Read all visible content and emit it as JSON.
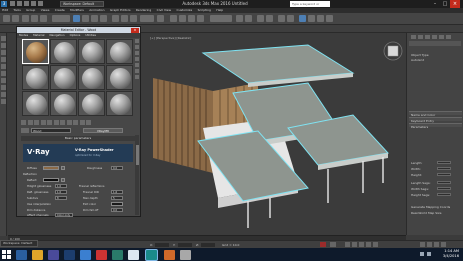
{
  "titlebar": {
    "workspace": "Workspace: Default",
    "title": "Autodesk 3ds Max 2016     Untitled",
    "search_placeholder": "Type a keyword or phrase"
  },
  "menubar": [
    "Edit",
    "Tools",
    "Group",
    "Views",
    "Create",
    "Modifiers",
    "Animation",
    "Graph Editors",
    "Rendering",
    "Civil View",
    "Customize",
    "Scripting",
    "Help"
  ],
  "viewport": {
    "label": "[+] [Perspective] [Realistic]"
  },
  "material_editor": {
    "title": "Material Editor - Wood",
    "menu": [
      "Modes",
      "Material",
      "Navigation",
      "Options",
      "Utilities"
    ],
    "material_name": "Wood",
    "material_type": "VRayMtl",
    "basic_header": "Basic parameters",
    "vray_logo": "V·Ray",
    "vray_caption": "V-Ray PowerShader",
    "vray_sub": "optimized for V-Ray",
    "params": {
      "diffuse": "Diffuse",
      "roughness": "Roughness",
      "reflection": "Reflection",
      "reflect": "Reflect",
      "hilight": "Hilight glossiness",
      "refl_gloss": "Refl. glossiness",
      "subdivs": "Subdivs",
      "use_interp": "Use interpolation",
      "dim_distance": "Dim distance",
      "affect_channels": "Affect channels",
      "fresnel": "Fresnel reflections",
      "fresnel_ior": "Fresnel IOR",
      "max_depth": "Max depth",
      "exit_color": "Exit color",
      "dim_falloff": "Dim fall off",
      "color_only": "Color only",
      "roughness_val": "0.0",
      "hilight_val": "1.0",
      "gloss_val": "1.0",
      "subdivs_val": "8",
      "ior_val": "1.6",
      "depth_val": "5",
      "falloff_val": "0.0"
    }
  },
  "command_panel": {
    "object_type": "Object Type",
    "autogrid": "AutoGrid",
    "params": [
      "Name and Color",
      "Keyboard Entry",
      "Parameters"
    ],
    "rows": [
      "Length:",
      "Width:",
      "Height:",
      "Length Segs:",
      "Width Segs:",
      "Height Segs:"
    ],
    "checks": [
      "Generate Mapping Coords",
      "Real-World Map Size"
    ]
  },
  "statusbar": {
    "workspace_bottom": "Workspace: Default",
    "frame": "0 / 100",
    "x": "X:",
    "y": "Y:",
    "z": "Z:",
    "grid": "Grid = 10.0"
  },
  "taskbar": {
    "time": "1:14 AM",
    "date": "3/4/2016"
  },
  "colors": {
    "accent": "#2a6fa8",
    "selection_outline": "#7fe3f2",
    "roof": "#8e958f",
    "wood": "#8b6a47",
    "vray_blue": "#233b55"
  }
}
